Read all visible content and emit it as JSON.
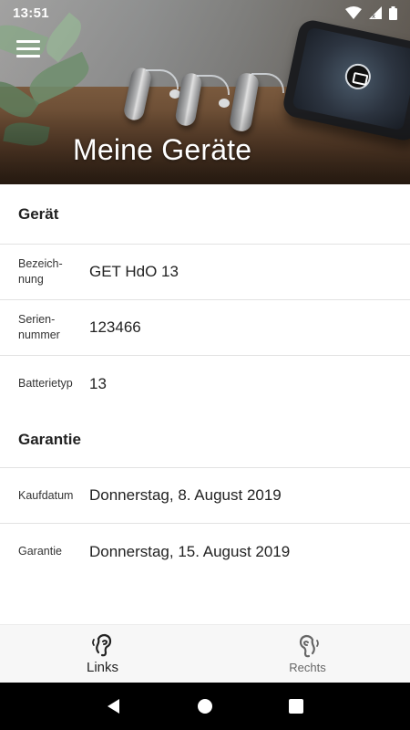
{
  "status_bar": {
    "time": "13:51",
    "icons": [
      "wifi-icon",
      "signal-icon",
      "battery-icon"
    ]
  },
  "header": {
    "title": "Meine Geräte",
    "menu_icon": "hamburger-menu-icon"
  },
  "device_section": {
    "title": "Gerät",
    "rows": [
      {
        "label": "Bezeich-\nnung",
        "value": "GET HdO 13"
      },
      {
        "label": "Serien-\nnummer",
        "value": "123466"
      },
      {
        "label": "Batterietyp",
        "value": "13"
      }
    ]
  },
  "warranty_section": {
    "title": "Garantie",
    "rows": [
      {
        "label": "Kaufdatum",
        "value": "Donnerstag, 8. August 2019"
      },
      {
        "label": "Garantie",
        "value": "Donnerstag, 15. August 2019"
      }
    ]
  },
  "bottom_nav": {
    "tabs": [
      {
        "label": "Links",
        "icon": "left-ear-icon",
        "active": true
      },
      {
        "label": "Rechts",
        "icon": "right-ear-icon",
        "active": false
      }
    ]
  },
  "system_nav": {
    "buttons": [
      "back-icon",
      "home-icon",
      "recents-icon"
    ]
  }
}
